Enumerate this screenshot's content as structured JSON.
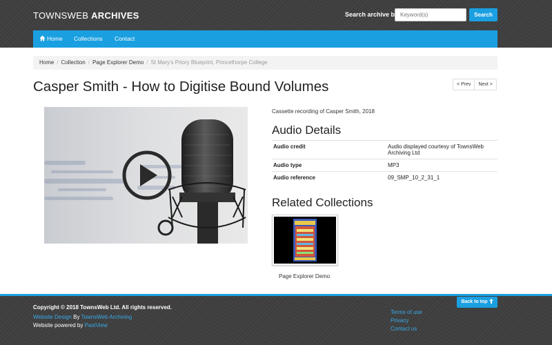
{
  "header": {
    "brand_light": "TOWNSWEB ",
    "brand_bold": "ARCHIVES",
    "search_label": "Search archive by",
    "search_placeholder": "Keyword(s)",
    "search_button": "Search"
  },
  "nav": {
    "home": "Home",
    "collections": "Collections",
    "contact": "Contact"
  },
  "breadcrumb": {
    "items": [
      "Home",
      "Collection",
      "Page Explorer Demo"
    ],
    "current": "St Mary's Priory Blueprint, Princethorpe College"
  },
  "page": {
    "title": "Casper Smith - How to Digitise Bound Volumes",
    "prev": "< Prev",
    "next": "Next >",
    "caption": "Cassette recording of Casper Smith, 2018"
  },
  "audio_details": {
    "heading": "Audio Details",
    "rows": [
      {
        "key": "Audio credit",
        "value": "Audio displayed courtesy of TownsWeb Archiving Ltd"
      },
      {
        "key": "Audio type",
        "value": "MP3"
      },
      {
        "key": "Audio reference",
        "value": "09_SMP_10_2_31_1"
      }
    ]
  },
  "related": {
    "heading": "Related Collections",
    "items": [
      {
        "label": "Page Explorer Demo"
      }
    ]
  },
  "footer": {
    "copyright": "Copyright © 2018 TownsWeb Ltd. All rights reserved.",
    "design_link": "Website Design",
    "design_by": " By ",
    "design_company": "TownsWeb Archiving",
    "powered_text": "Website powered by ",
    "powered_link": "PastView",
    "links": [
      "Terms of use",
      "Privacy",
      "Contact us"
    ],
    "back_to_top": "Back to top"
  },
  "colors": {
    "accent": "#1a9fe0",
    "header_bg": "#3f3f3f"
  },
  "icons": [
    "home-icon",
    "play-icon",
    "arrow-up-icon"
  ]
}
